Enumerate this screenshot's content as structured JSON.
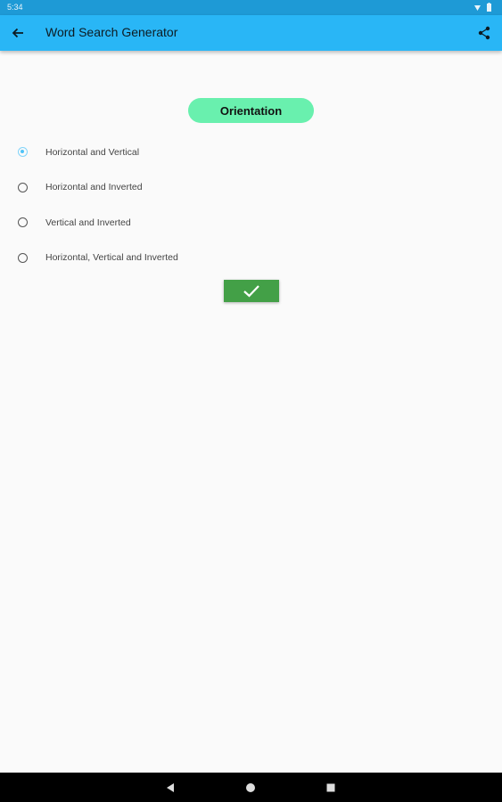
{
  "status_bar": {
    "time": "5:34",
    "icons": [
      "wifi-icon",
      "battery-icon"
    ]
  },
  "app_bar": {
    "title": "Word Search Generator",
    "back_icon": "arrow-back-icon",
    "share_icon": "share-icon"
  },
  "section": {
    "title": "Orientation"
  },
  "options": [
    {
      "label": "Horizontal and Vertical",
      "selected": true
    },
    {
      "label": "Horizontal and Inverted",
      "selected": false
    },
    {
      "label": "Vertical and Inverted",
      "selected": false
    },
    {
      "label": "Horizontal, Vertical and Inverted",
      "selected": false
    }
  ],
  "confirm": {
    "icon": "checkmark-icon"
  },
  "nav_bar": {
    "icons": [
      "back-triangle-icon",
      "home-circle-icon",
      "recents-square-icon"
    ]
  },
  "colors": {
    "status_bar": "#1e9ad6",
    "app_bar": "#29b6f6",
    "pill": "#69f0ae",
    "confirm": "#43a047",
    "radio_selected": "#4fc3f7"
  }
}
